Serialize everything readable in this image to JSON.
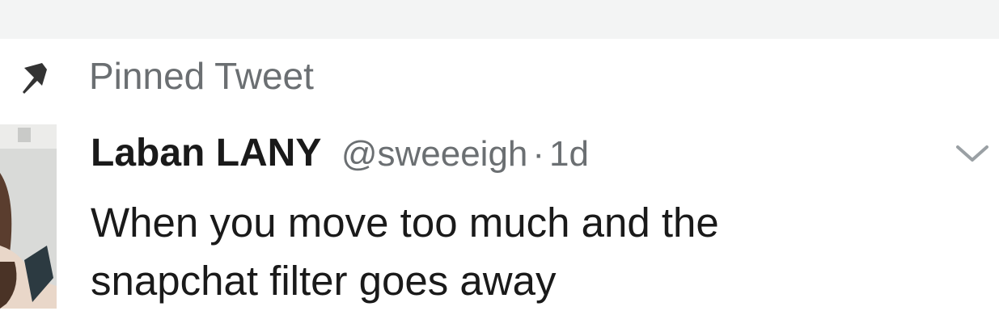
{
  "pinned": {
    "label": "Pinned Tweet",
    "icon": "pin-icon"
  },
  "tweet": {
    "display_name": "Laban LANY",
    "handle": "@sweeeigh",
    "separator": "·",
    "time": "1d",
    "text_lines": [
      "When you move too much and the",
      "snapchat filter goes away"
    ],
    "menu_icon": "chevron-down-icon",
    "avatar_icon": "avatar"
  },
  "colors": {
    "primary_text": "#1a1a1a",
    "secondary_text": "#6b6f72",
    "background": "#ffffff"
  }
}
